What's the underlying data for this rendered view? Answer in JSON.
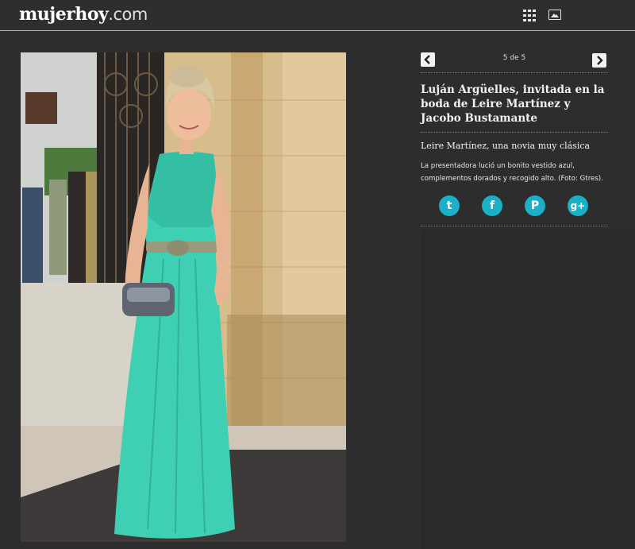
{
  "header": {
    "logo_bold": "mujerhoy",
    "logo_light": ".com",
    "grid_icon": "grid-icon",
    "gallery_icon": "image-icon"
  },
  "gallery": {
    "counter": "5 de 5",
    "prev_icon": "chevron-left-icon",
    "next_icon": "chevron-right-icon",
    "title": "Luján Argüelles, invitada en la boda de Leire Martínez y Jacobo Bustamante",
    "subtitle": "Leire Martínez, una novia muy clásica",
    "description": "La presentadora lució un bonito vestido azul, complementos dorados y recogido alto. (Foto: Gtres).",
    "social": [
      {
        "name": "twitter",
        "icon": "twitter-icon",
        "glyph": "t"
      },
      {
        "name": "facebook",
        "icon": "facebook-icon",
        "glyph": "f"
      },
      {
        "name": "pinterest",
        "icon": "pinterest-icon",
        "glyph": "P"
      },
      {
        "name": "google-plus",
        "icon": "google-plus-icon",
        "glyph": "g+"
      }
    ]
  },
  "colors": {
    "background": "#2d2d2d",
    "social": "#1ab0c8",
    "dress": "#3fcfb3"
  }
}
